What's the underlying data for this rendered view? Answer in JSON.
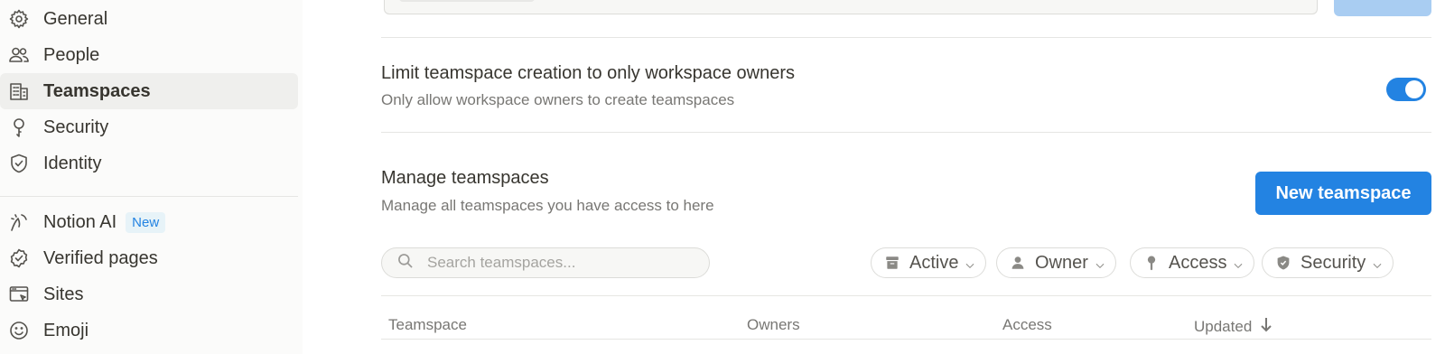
{
  "sidebar": {
    "items": [
      {
        "label": "General",
        "icon": "gear-icon"
      },
      {
        "label": "People",
        "icon": "people-icon"
      },
      {
        "label": "Teamspaces",
        "icon": "building-icon",
        "active": true
      },
      {
        "label": "Security",
        "icon": "key-icon"
      },
      {
        "label": "Identity",
        "icon": "shield-check-icon"
      },
      {
        "label": "Notion AI",
        "icon": "ai-icon",
        "badge": "New"
      },
      {
        "label": "Verified pages",
        "icon": "verified-badge-icon"
      },
      {
        "label": "Sites",
        "icon": "browser-window-icon"
      },
      {
        "label": "Emoji",
        "icon": "smiley-icon"
      }
    ]
  },
  "settings": {
    "limit_title": "Limit teamspace creation to only workspace owners",
    "limit_desc": "Only allow workspace owners to create teamspaces",
    "limit_enabled": true,
    "manage_title": "Manage teamspaces",
    "manage_desc": "Manage all teamspaces you have access to here",
    "new_button": "New teamspace"
  },
  "search": {
    "placeholder": "Search teamspaces..."
  },
  "filters": [
    {
      "label": "Active",
      "icon": "archive-icon"
    },
    {
      "label": "Owner",
      "icon": "person-icon"
    },
    {
      "label": "Access",
      "icon": "key-icon"
    },
    {
      "label": "Security",
      "icon": "shield-icon"
    }
  ],
  "table": {
    "columns": [
      "Teamspace",
      "Owners",
      "Access",
      "Updated"
    ],
    "sort_icon": "arrow-down-icon"
  },
  "colors": {
    "accent": "#2383e2",
    "sidebar_bg": "#fbfbfa",
    "active_bg": "#efefed"
  }
}
